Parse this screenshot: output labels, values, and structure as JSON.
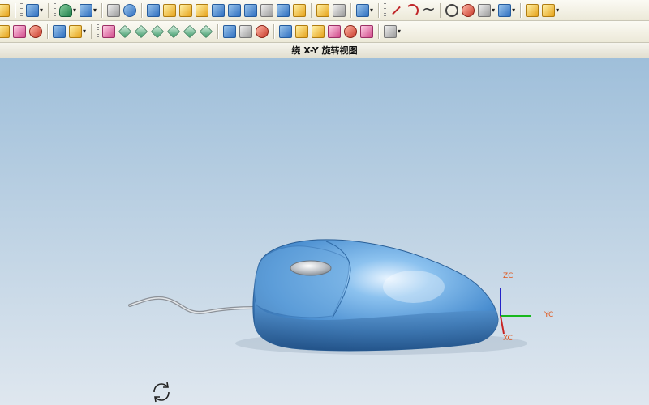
{
  "view_title": "绕 X-Y 旋转视图",
  "axes": {
    "zc": "ZC",
    "yc": "YC",
    "xc": "XC"
  },
  "colors": {
    "mouse_body": "#5fa0d8",
    "background_top": "#9fbfda",
    "background_bottom": "#dfe7ef"
  },
  "toolbar_row1": [
    "icon",
    "dd",
    "sep",
    "grip",
    "icon",
    "dd",
    "sep",
    "grip",
    "icon",
    "dd",
    "icon",
    "dd",
    "sep",
    "icon",
    "icon",
    "sep",
    "icon",
    "icon",
    "icon",
    "icon",
    "icon",
    "icon",
    "icon",
    "icon",
    "icon",
    "icon",
    "sep",
    "icon",
    "icon",
    "sep",
    "icon",
    "dd",
    "sep",
    "grip",
    "icon",
    "icon",
    "icon",
    "sep",
    "icon",
    "icon",
    "icon",
    "dd",
    "icon",
    "dd",
    "sep",
    "icon",
    "icon",
    "dd"
  ],
  "toolbar_row2": [
    "icon",
    "icon",
    "icon",
    "sep",
    "icon",
    "icon",
    "dd",
    "sep",
    "grip",
    "icon",
    "icon",
    "icon",
    "icon",
    "icon",
    "icon",
    "icon",
    "sep",
    "icon",
    "icon",
    "icon",
    "sep",
    "icon",
    "icon",
    "icon",
    "icon",
    "icon",
    "icon",
    "sep",
    "icon",
    "dd"
  ]
}
